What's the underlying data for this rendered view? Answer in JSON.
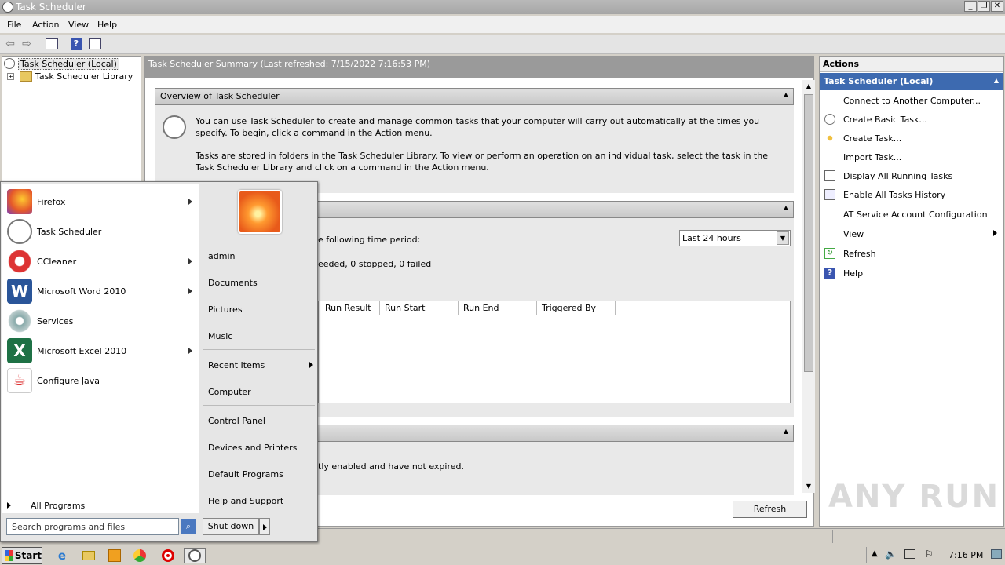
{
  "window": {
    "title": "Task Scheduler"
  },
  "menus": [
    "File",
    "Action",
    "View",
    "Help"
  ],
  "tree": {
    "root": "Task Scheduler (Local)",
    "library": "Task Scheduler Library"
  },
  "summary": {
    "header": "Task Scheduler Summary (Last refreshed: 7/15/2022 7:16:53 PM)",
    "overview_title": "Overview of Task Scheduler",
    "overview_p1": "You can use Task Scheduler to create and manage common tasks that your computer will carry out automatically at the times you specify. To begin, click a command in the Action menu.",
    "overview_p2": "Tasks are stored in folders in the Task Scheduler Library. To view or perform an operation on an individual task, select the task in the Task Scheduler Library and click on a command in the Action menu.",
    "status_partial": "e following time period:",
    "status_counts_partial": "eeded, 0 stopped, 0 failed",
    "period_value": "Last 24 hours",
    "columns": [
      "Run Result",
      "Run Start",
      "Run End",
      "Triggered By"
    ],
    "active_partial": "tly enabled and have not expired.",
    "refresh": "Refresh"
  },
  "actions": {
    "header": "Actions",
    "group": "Task Scheduler (Local)",
    "items": [
      "Connect to Another Computer...",
      "Create Basic Task...",
      "Create Task...",
      "Import Task...",
      "Display All Running Tasks",
      "Enable All Tasks History",
      "AT Service Account Configuration",
      "View",
      "Refresh",
      "Help"
    ]
  },
  "startmenu": {
    "programs": [
      "Firefox",
      "Task Scheduler",
      "CCleaner",
      "Microsoft Word 2010",
      "Services",
      "Microsoft Excel 2010",
      "Configure Java"
    ],
    "all_programs": "All Programs",
    "search_placeholder": "Search programs and files",
    "right": [
      "admin",
      "Documents",
      "Pictures",
      "Music",
      "Recent Items",
      "Computer",
      "Control Panel",
      "Devices and Printers",
      "Default Programs",
      "Help and Support"
    ],
    "shutdown": "Shut down"
  },
  "taskbar": {
    "start": "Start",
    "clock": "7:16 PM"
  },
  "watermark": "ANY RUN"
}
